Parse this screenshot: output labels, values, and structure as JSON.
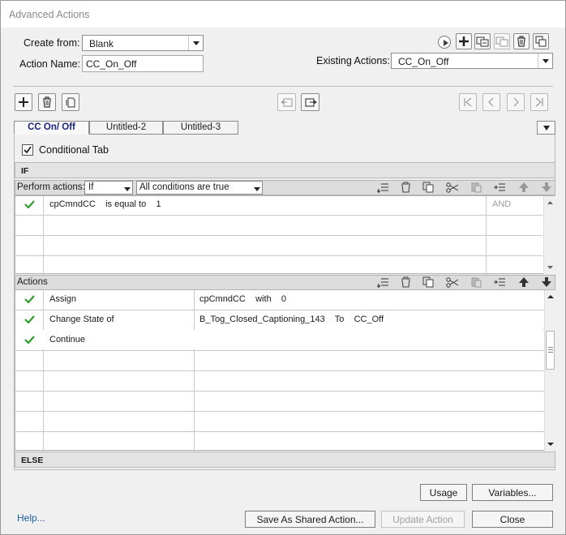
{
  "window": {
    "title": "Advanced Actions"
  },
  "form": {
    "create_from_label": "Create from:",
    "create_from_value": "Blank",
    "action_name_label": "Action Name:",
    "action_name_value": "CC_On_Off",
    "existing_actions_label": "Existing Actions:",
    "existing_actions_value": "CC_On_Off"
  },
  "tabs": [
    {
      "label": "CC On/ Off",
      "active": true
    },
    {
      "label": "Untitled-2",
      "active": false
    },
    {
      "label": "Untitled-3",
      "active": false
    }
  ],
  "conditional_tab_label": "Conditional Tab",
  "conditional_tab_checked": true,
  "if_section": {
    "header": "IF",
    "perform_actions_label": "Perform actions:",
    "perform_value": "If",
    "conditions_value": "All conditions are true",
    "rows": [
      {
        "checked": true,
        "condition": "cpCmndCC    is equal to    1",
        "operator": "AND"
      }
    ]
  },
  "actions_section": {
    "header": "Actions",
    "rows": [
      {
        "checked": true,
        "action": "Assign",
        "target": "cpCmndCC    with    0"
      },
      {
        "checked": true,
        "action": "Change State of",
        "target": "B_Tog_Closed_Captioning_143    To    CC_Off"
      },
      {
        "checked": true,
        "action": "Continue",
        "target": ""
      }
    ]
  },
  "else_section": {
    "header": "ELSE"
  },
  "buttons": {
    "usage": "Usage",
    "variables": "Variables...",
    "help": "Help...",
    "save_shared": "Save As Shared Action...",
    "update": "Update Action",
    "close": "Close"
  },
  "colors": {
    "check": "#2e9e2e",
    "link": "#1f5fa8",
    "active_tab_text": "#1a237e"
  }
}
